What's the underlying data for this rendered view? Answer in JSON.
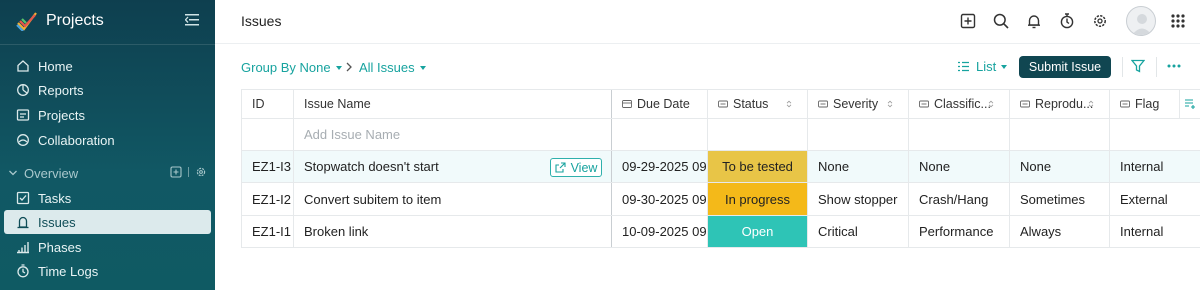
{
  "app": {
    "name": "Projects"
  },
  "sidebar": {
    "items": [
      {
        "label": "Home",
        "icon": "home-icon"
      },
      {
        "label": "Reports",
        "icon": "reports-icon"
      },
      {
        "label": "Projects",
        "icon": "projects-icon"
      },
      {
        "label": "Collaboration",
        "icon": "collaboration-icon"
      }
    ],
    "section": {
      "label": "Overview"
    },
    "section_items": [
      {
        "label": "Tasks",
        "icon": "tasks-icon"
      },
      {
        "label": "Issues",
        "icon": "issues-icon",
        "active": true
      },
      {
        "label": "Phases",
        "icon": "phases-icon"
      },
      {
        "label": "Time Logs",
        "icon": "timelogs-icon"
      }
    ]
  },
  "header": {
    "title": "Issues"
  },
  "toolbar": {
    "group_by": "Group By None",
    "filter_view": "All Issues",
    "list_label": "List",
    "submit_label": "Submit Issue"
  },
  "table": {
    "columns": [
      "ID",
      "Issue Name",
      "Due Date",
      "Status",
      "Severity",
      "Classific...",
      "Reprodu...",
      "Flag"
    ],
    "add_placeholder": "Add Issue Name",
    "view_label": "View",
    "rows": [
      {
        "id": "EZ1-I3",
        "name": "Stopwatch doesn't start",
        "due": "09-29-2025 09",
        "status": "To be tested",
        "severity": "None",
        "classification": "None",
        "reproducible": "None",
        "flag": "Internal"
      },
      {
        "id": "EZ1-I2",
        "name": "Convert subitem to item",
        "due": "09-30-2025 09",
        "status": "In progress",
        "severity": "Show stopper",
        "classification": "Crash/Hang",
        "reproducible": "Sometimes",
        "flag": "External"
      },
      {
        "id": "EZ1-I1",
        "name": "Broken link",
        "due": "10-09-2025 09:",
        "status": "Open",
        "severity": "Critical",
        "classification": "Performance",
        "reproducible": "Always",
        "flag": "Internal"
      }
    ]
  },
  "colors": {
    "sidebar": "#0e4a57",
    "accent": "#17a39f",
    "submit": "#104651",
    "status_to_be_tested": "#e8c547",
    "status_in_progress": "#f4b919",
    "status_open": "#2ec4b6"
  }
}
